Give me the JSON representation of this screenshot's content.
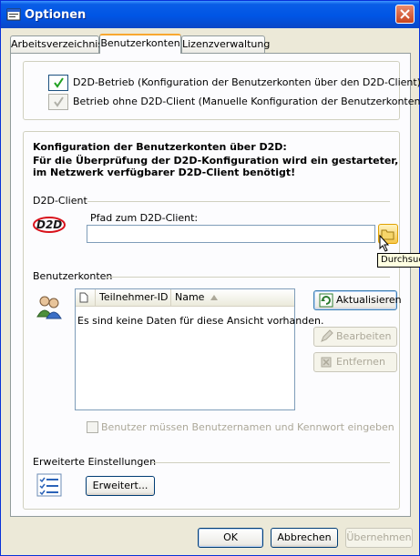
{
  "window": {
    "title": "Optionen"
  },
  "tabs": [
    {
      "label": "Arbeitsverzeichnis"
    },
    {
      "label": "Benutzerkonten"
    },
    {
      "label": "Lizenzverwaltung"
    }
  ],
  "mode": {
    "option1": "D2D-Betrieb (Konfiguration der Benutzerkonten über den D2D-Client)",
    "option2": "Betrieb ohne D2D-Client (Manuelle Konfiguration der Benutzerkonten)",
    "option1_checked": true,
    "option2_checked": true
  },
  "config": {
    "heading": "Konfiguration der Benutzerkonten über D2D:",
    "note_line1": "Für die Überprüfung der D2D-Konfiguration wird ein gestarteter,",
    "note_line2": "im Netzwerk verfügbarer D2D-Client benötigt!"
  },
  "d2d_client": {
    "section": "D2D-Client",
    "logo_text": "D2D",
    "path_label": "Pfad zum D2D-Client:",
    "path_value": "",
    "tooltip": "Durchsuchen"
  },
  "accounts": {
    "section": "Benutzerkonten",
    "columns": [
      "",
      "Teilnehmer-ID",
      "Name"
    ],
    "empty_text": "Es sind keine Daten für diese Ansicht vorhanden.",
    "refresh_label": "Aktualisieren",
    "edit_label": "Bearbeiten",
    "remove_label": "Entfernen",
    "require_credentials": "Benutzer müssen Benutzernamen und Kennwort eingeben"
  },
  "advanced": {
    "section": "Erweiterte Einstellungen",
    "button_label": "Erweitert..."
  },
  "footer": {
    "ok": "OK",
    "cancel": "Abbrechen",
    "apply": "Übernehmen"
  },
  "colors": {
    "titlebar": "#0055e5",
    "dialog": "#ece9d8",
    "active_tab_accent": "#f8a830",
    "logo_red": "#d8121b"
  }
}
